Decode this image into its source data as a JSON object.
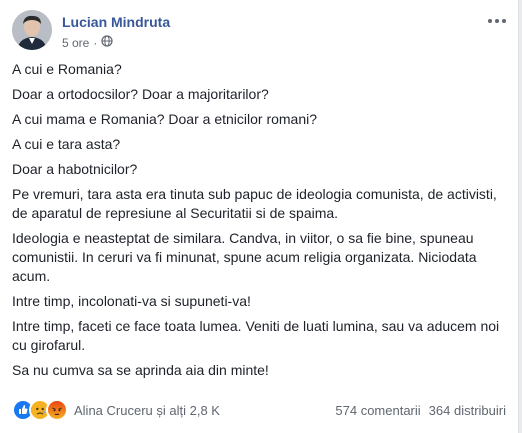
{
  "post": {
    "author": "Lucian Mindruta",
    "time": "5 ore",
    "audience_icon": "globe-icon",
    "paragraphs": [
      "A cui e Romania?",
      "Doar a ortodocsilor? Doar a majoritarilor?",
      "A cui mama e Romania? Doar a etnicilor romani?",
      "A cui e tara asta?",
      "Doar a habotnicilor?",
      "Pe vremuri, tara asta era tinuta sub papuc de ideologia comunista, de activisti, de aparatul de represiune al Securitatii si de spaima.",
      "Ideologia e neasteptat de similara. Candva, in viitor, o sa fie bine, spuneau comunistii. In ceruri va fi minunat, spune acum religia organizata. Niciodata acum.",
      "Intre timp, incolonati-va si supuneti-va!",
      "Intre timp, faceti ce face toata lumea. Veniti de luati lumina, sau va aducem noi cu girofarul.",
      "Sa nu cumva sa se aprinda aia din minte!"
    ]
  },
  "footer": {
    "reaction_icons": [
      "like-icon",
      "sad-icon",
      "angry-icon"
    ],
    "reactors": "Alina Cruceru și alți 2,8 K",
    "comments": "574 comentarii",
    "shares": "364 distribuiri"
  },
  "colors": {
    "author": "#385898",
    "text": "#1d2129",
    "meta": "#616770",
    "like": "#1877f2",
    "sad": "#f7b125",
    "angry": "#e9710f"
  }
}
